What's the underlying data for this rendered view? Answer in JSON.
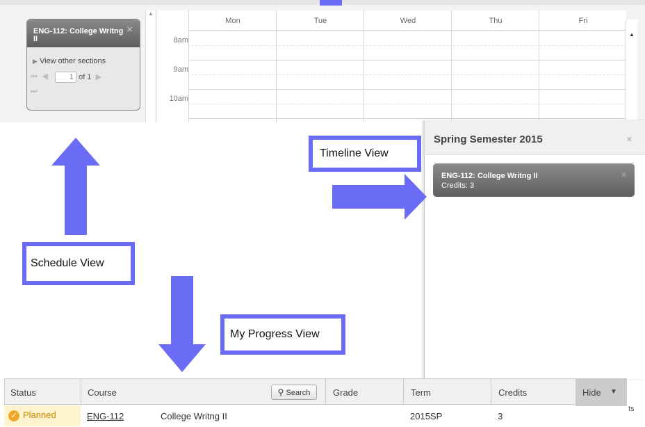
{
  "schedule": {
    "card": {
      "title": "ENG-112: College Writng II",
      "close": "✕",
      "view_other": "View other sections",
      "page_value": "1",
      "page_of": "of 1"
    },
    "days": [
      "Mon",
      "Tue",
      "Wed",
      "Thu",
      "Fri"
    ],
    "times": [
      "8am",
      "9am",
      "10am"
    ]
  },
  "timeline": {
    "title": "Spring Semester 2015",
    "close": "×",
    "card": {
      "title": "ENG-112: College Writng II",
      "credits": "Credits: 3",
      "close": "✕"
    }
  },
  "labels": {
    "timeline_view": "Timeline View",
    "schedule_view": "Schedule View",
    "progress_view": "My Progress View"
  },
  "progress": {
    "headers": {
      "status": "Status",
      "course": "Course",
      "search": "Search",
      "grade": "Grade",
      "term": "Term",
      "credits": "Credits",
      "hide": "Hide"
    },
    "row": {
      "status": "Planned",
      "course": "ENG-112",
      "title": "College Writng II",
      "term": "2015SP",
      "credits": "3"
    },
    "edge_text": "ts"
  },
  "colors": {
    "accent": "#6a6cf5",
    "planned_bg": "#fdf3cf",
    "planned_text": "#c98a00",
    "card_gray": "#6f6f6f"
  }
}
